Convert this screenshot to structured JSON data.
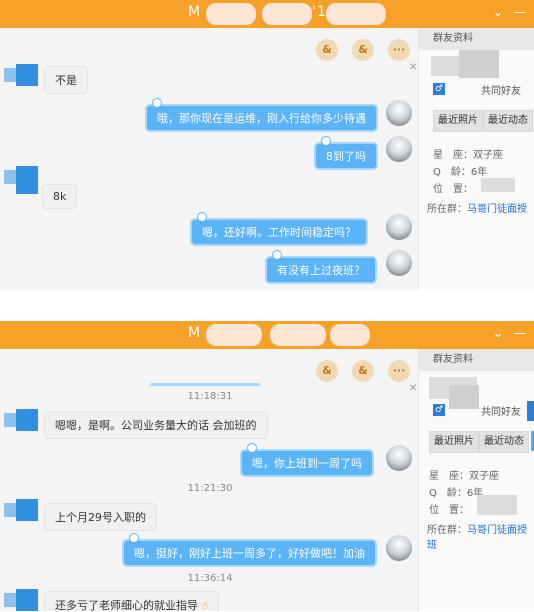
{
  "panel1": {
    "title_prefix": "M",
    "title_suffix": "'1",
    "toolbar": {
      "add_member": "&",
      "add_friend": "&",
      "more": "···"
    },
    "messages": [
      {
        "side": "left",
        "text": "不是"
      },
      {
        "side": "right",
        "text": "哦，那你现在是运维，刚入行给你多少待遇"
      },
      {
        "side": "right",
        "text": "8到了吗"
      },
      {
        "side": "left",
        "text": "8k"
      },
      {
        "side": "right",
        "text": "嗯，还好啊。工作时间稳定吗？"
      },
      {
        "side": "right",
        "text": "有没有上过夜班？"
      }
    ],
    "sidebar": {
      "header": "群友资料",
      "gender_icon": "♂",
      "common_friends": "共同好友",
      "btn_photos": "最近照片",
      "btn_activity": "最近动态",
      "constellation_label": "星　座：",
      "constellation_value": "双子座",
      "q_age_label": "Q　龄：",
      "q_age_value": "6年",
      "location_label": "位　置：",
      "location_value": "",
      "group_label": "所在群：",
      "group_value": "马哥门徒面授"
    }
  },
  "panel2": {
    "title_prefix": "M",
    "title_suffix": "",
    "toolbar": {
      "add_member": "&",
      "add_friend": "&",
      "more": "···"
    },
    "timestamps": [
      "11:18:31",
      "11:21:30",
      "11:36:14"
    ],
    "messages": [
      {
        "side": "left",
        "text": "嗯嗯，是啊。公司业务量大的话 会加班的"
      },
      {
        "side": "right",
        "text": "嗯，你上班到一周了吗"
      },
      {
        "side": "left",
        "text": "上个月29号入职的"
      },
      {
        "side": "right",
        "text": "嗯，挺好，刚好上班一周多了，好好做吧！加油"
      },
      {
        "side": "left",
        "text": "还多亏了老师细心的就业指导"
      }
    ],
    "sidebar": {
      "header": "群友资料",
      "gender_icon": "♂",
      "common_friends": "共同好友",
      "btn_photos": "最近照片",
      "btn_activity": "最近动态",
      "constellation_label": "星　座：",
      "constellation_value": "双子座",
      "q_age_label": "Q　龄：",
      "q_age_value": "6年",
      "location_label": "位　置：",
      "location_value": "",
      "group_label": "所在群：",
      "group_value": "马哥门徒面授班"
    }
  },
  "window_controls": {
    "minimize": "—",
    "dropdown": "⌄"
  },
  "colors": {
    "titlebar": "#f7a129",
    "bubble_right": "#5ab4f7",
    "link": "#1b6fcf"
  }
}
